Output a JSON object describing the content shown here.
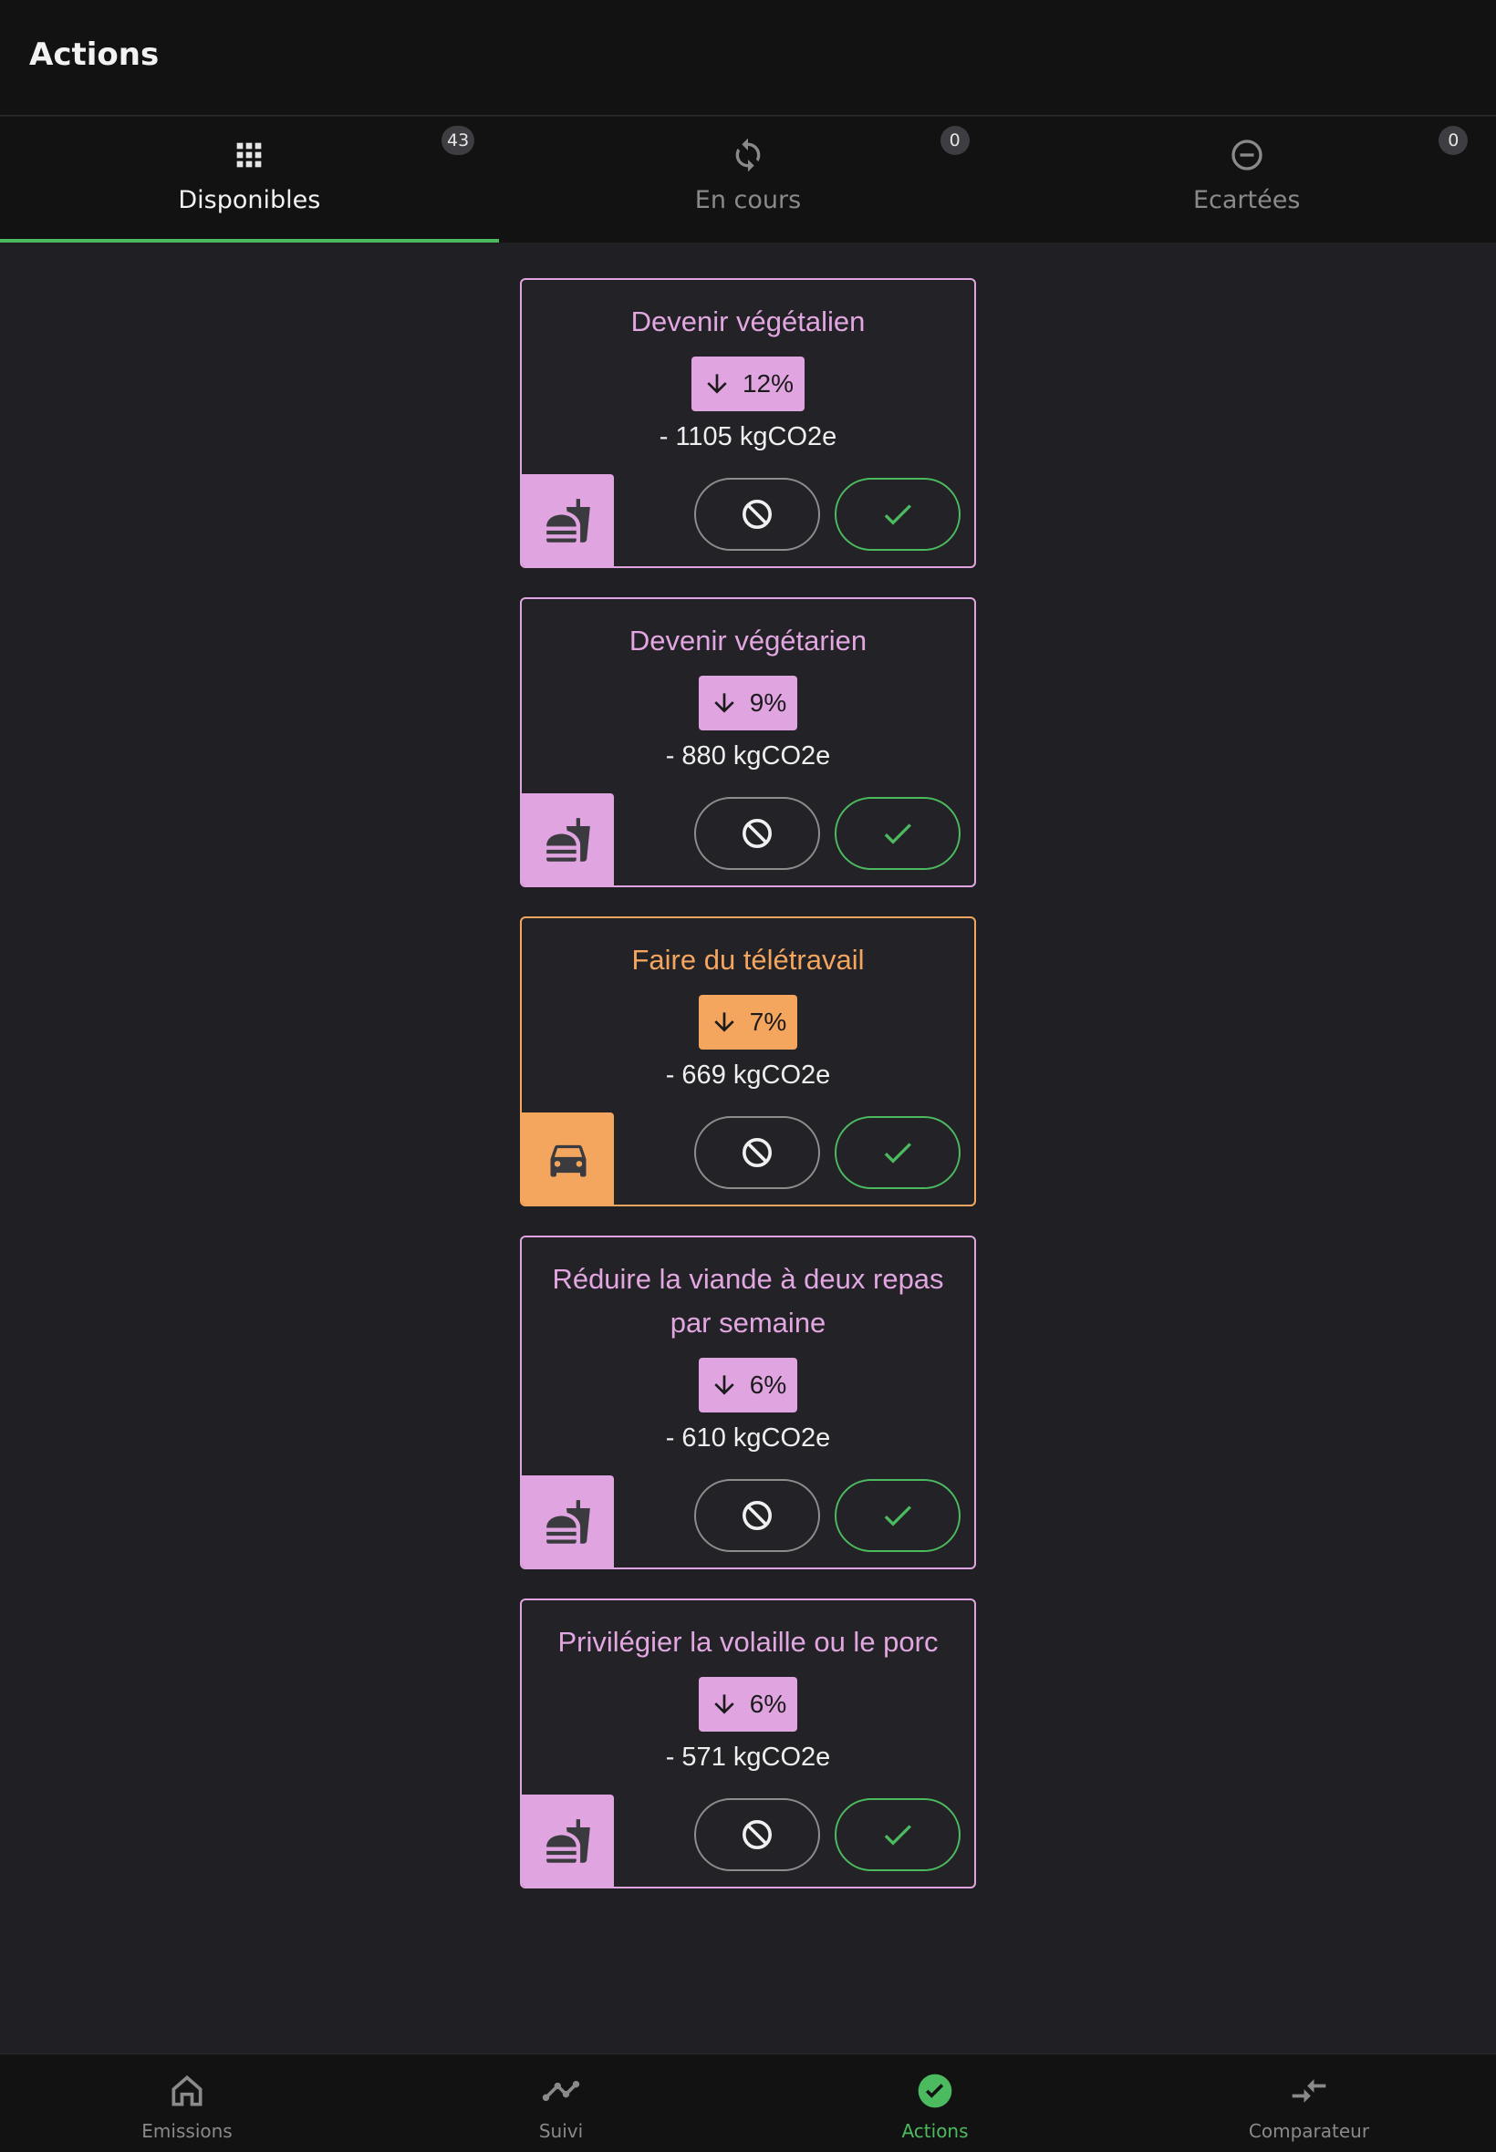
{
  "appbar": {
    "title": "Actions"
  },
  "tabs": [
    {
      "label": "Disponibles",
      "badge": "43",
      "icon": "grid-icon",
      "active": true
    },
    {
      "label": "En cours",
      "badge": "0",
      "icon": "sync-icon",
      "active": false
    },
    {
      "label": "Ecartées",
      "badge": "0",
      "icon": "minus-circle-icon",
      "active": false
    }
  ],
  "cards": [
    {
      "title": "Devenir végétalien",
      "percent": "12%",
      "amount": "- 1105 kgCO2e",
      "category": "food",
      "category_icon": "fastfood-icon"
    },
    {
      "title": "Devenir végétarien",
      "percent": "9%",
      "amount": "- 880 kgCO2e",
      "category": "food",
      "category_icon": "fastfood-icon"
    },
    {
      "title": "Faire du télétravail",
      "percent": "7%",
      "amount": "- 669 kgCO2e",
      "category": "transport",
      "category_icon": "car-icon"
    },
    {
      "title": "Réduire la viande à deux repas par semaine",
      "percent": "6%",
      "amount": "- 610 kgCO2e",
      "category": "food",
      "category_icon": "fastfood-icon"
    },
    {
      "title": "Privilégier la volaille ou le porc",
      "percent": "6%",
      "amount": "- 571 kgCO2e",
      "category": "food",
      "category_icon": "fastfood-icon"
    }
  ],
  "bottom_nav": [
    {
      "label": "Emissions",
      "icon": "home-icon",
      "active": false
    },
    {
      "label": "Suivi",
      "icon": "trend-icon",
      "active": false
    },
    {
      "label": "Actions",
      "icon": "check-circle-icon",
      "active": true
    },
    {
      "label": "Comparateur",
      "icon": "compare-arrows-icon",
      "active": false
    }
  ],
  "colors": {
    "accent": "#4cba5f",
    "food": "#e0a4e0",
    "transport": "#f4a55e",
    "background": "#202024",
    "bar": "#121212"
  }
}
